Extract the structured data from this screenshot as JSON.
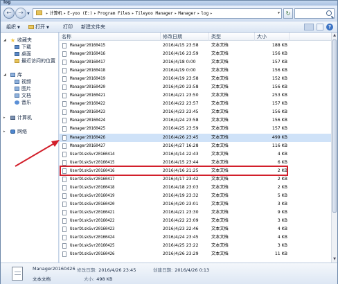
{
  "window": {
    "title": "log"
  },
  "address": {
    "segments": [
      "计算机",
      "E-yoo (E:)",
      "Program Files",
      "Tileyoo Manager",
      "Manager",
      "log"
    ]
  },
  "toolbar": {
    "organize": "组织",
    "open": "打开",
    "print": "打印",
    "new_folder": "新建文件夹"
  },
  "nav": {
    "favorites": "收藏夹",
    "downloads": "下载",
    "desktop": "桌面",
    "recent": "最近访问的位置",
    "libraries": "库",
    "videos": "视频",
    "pictures": "图片",
    "documents": "文档",
    "music": "音乐",
    "computer": "计算机",
    "network": "网络"
  },
  "columns": {
    "name": "名称",
    "date": "修改日期",
    "type": "类型",
    "size": "大小"
  },
  "files": [
    {
      "name": "Manager20160415",
      "date": "2016/4/15 23:58",
      "type": "文本文档",
      "size": "188 KB"
    },
    {
      "name": "Manager20160416",
      "date": "2016/4/16 23:59",
      "type": "文本文档",
      "size": "156 KB"
    },
    {
      "name": "Manager20160417",
      "date": "2016/4/18 0:00",
      "type": "文本文档",
      "size": "157 KB"
    },
    {
      "name": "Manager20160418",
      "date": "2016/4/19 0:00",
      "type": "文本文档",
      "size": "156 KB"
    },
    {
      "name": "Manager20160419",
      "date": "2016/4/19 23:58",
      "type": "文本文档",
      "size": "152 KB"
    },
    {
      "name": "Manager20160420",
      "date": "2016/4/20 23:58",
      "type": "文本文档",
      "size": "156 KB"
    },
    {
      "name": "Manager20160421",
      "date": "2016/4/21 23:50",
      "type": "文本文档",
      "size": "253 KB"
    },
    {
      "name": "Manager20160422",
      "date": "2016/4/22 23:57",
      "type": "文本文档",
      "size": "157 KB"
    },
    {
      "name": "Manager20160423",
      "date": "2016/4/23 23:45",
      "type": "文本文档",
      "size": "156 KB"
    },
    {
      "name": "Manager20160424",
      "date": "2016/4/24 23:58",
      "type": "文本文档",
      "size": "156 KB"
    },
    {
      "name": "Manager20160425",
      "date": "2016/4/25 23:59",
      "type": "文本文档",
      "size": "157 KB"
    },
    {
      "name": "Manager20160426",
      "date": "2016/4/26 23:45",
      "type": "文本文档",
      "size": "499 KB",
      "selected": true
    },
    {
      "name": "Manager20160427",
      "date": "2016/4/27 16:28",
      "type": "文本文档",
      "size": "116 KB"
    },
    {
      "name": "UserDiskSvr20160414",
      "date": "2016/4/14 22:43",
      "type": "文本文档",
      "size": "4 KB"
    },
    {
      "name": "UserDiskSvr20160415",
      "date": "2016/4/15 23:44",
      "type": "文本文档",
      "size": "6 KB"
    },
    {
      "name": "UserDiskSvr20160416",
      "date": "2016/4/16 21:25",
      "type": "文本文档",
      "size": "2 KB"
    },
    {
      "name": "UserDiskSvr20160417",
      "date": "2016/4/17 23:42",
      "type": "文本文档",
      "size": "2 KB"
    },
    {
      "name": "UserDiskSvr20160418",
      "date": "2016/4/18 23:03",
      "type": "文本文档",
      "size": "2 KB"
    },
    {
      "name": "UserDiskSvr20160419",
      "date": "2016/4/19 23:32",
      "type": "文本文档",
      "size": "5 KB"
    },
    {
      "name": "UserDiskSvr20160420",
      "date": "2016/4/20 23:01",
      "type": "文本文档",
      "size": "3 KB"
    },
    {
      "name": "UserDiskSvr20160421",
      "date": "2016/4/21 23:30",
      "type": "文本文档",
      "size": "9 KB"
    },
    {
      "name": "UserDiskSvr20160422",
      "date": "2016/4/22 23:09",
      "type": "文本文档",
      "size": "3 KB"
    },
    {
      "name": "UserDiskSvr20160423",
      "date": "2016/4/23 22:46",
      "type": "文本文档",
      "size": "4 KB"
    },
    {
      "name": "UserDiskSvr20160424",
      "date": "2016/4/24 23:45",
      "type": "文本文档",
      "size": "4 KB"
    },
    {
      "name": "UserDiskSvr20160425",
      "date": "2016/4/25 23:22",
      "type": "文本文档",
      "size": "3 KB"
    },
    {
      "name": "UserDiskSvr20160426",
      "date": "2016/4/26 23:29",
      "type": "文本文档",
      "size": "11 KB"
    }
  ],
  "details": {
    "filename": "Manager20160426",
    "modified_label": "修改日期:",
    "modified_value": "2016/4/26 23:45",
    "created_label": "创建日期:",
    "created_value": "2016/4/26 0:13",
    "type": "文本文档",
    "size_label": "大小:",
    "size_value": "498 KB"
  },
  "colors": {
    "highlight": "#d21f2b",
    "selection": "#cfe2f8",
    "chrome": "#dbe6f4"
  }
}
